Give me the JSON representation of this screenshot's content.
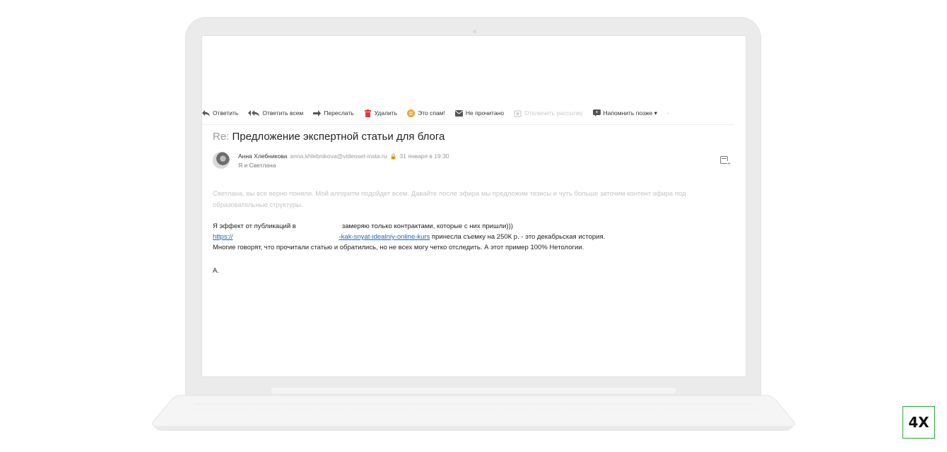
{
  "toolbar": {
    "reply": "Ответить",
    "reply_all": "Ответить всем",
    "forward": "Переслать",
    "delete": "Удалить",
    "spam": "Это спам!",
    "unread": "Не прочитано",
    "unsubscribe": "Отключить рассылку",
    "remind": "Напомнить позже ▾",
    "more": "·"
  },
  "mail": {
    "subject_prefix": "Re:",
    "subject": "Предложение экспертной статьи для блога",
    "sender_name": "Анна Хлебникова",
    "sender_email": "anna.khlebnikova@videoset-insta.ru",
    "date": "31 января в 19:30",
    "recipients": "Я и Светлана",
    "quoted": "Светлана, вы все верно поняли. Мой алгоритм подойдет всем. Давайте после эфира мы предложим тезисы и чуть больше заточим контент эфира под образовательные структуры.",
    "line1_a": "Я эффект от публикаций в",
    "line1_b": "замеряю только контрактами, которые с них пришли)))",
    "link_a": "https://",
    "link_b": "-kak-snyat-idealniy-online-kurs",
    "line2_rest": " принесла съемку на 250К р. - это декабрьская история.",
    "line3": "Многие говорят, что прочитали статью и обратились, но не всех могу четко отследить. А этот пример 100% Нетологии.",
    "signature": "А."
  },
  "badge": "4X",
  "colors": {
    "link": "#1a66c4",
    "badge_border": "#27a83a",
    "lock": "#55a32a",
    "delete_icon": "#e23a3a",
    "spam_icon": "#f3a230"
  }
}
